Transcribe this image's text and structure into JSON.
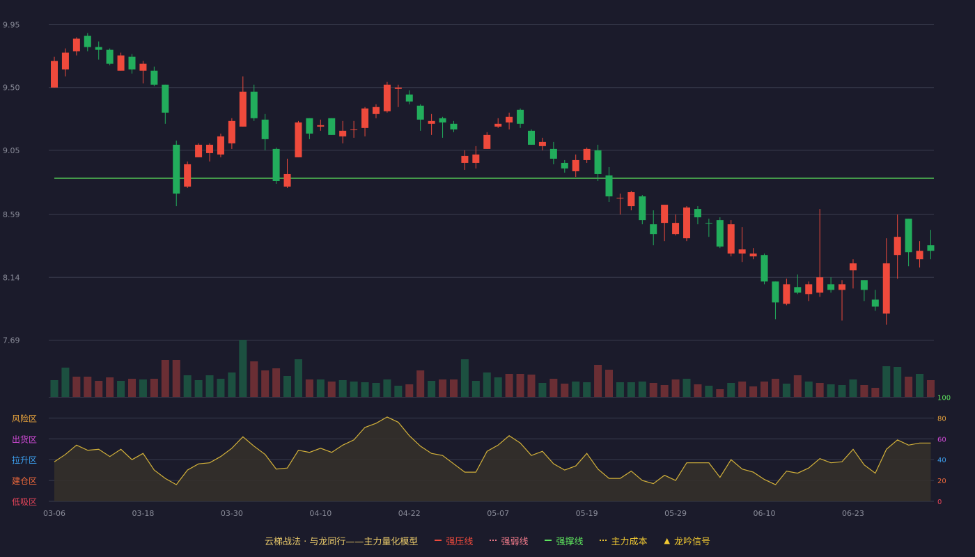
{
  "chart_data": {
    "type": "candlestick",
    "x_tick_labels": [
      "03-06",
      "03-18",
      "03-30",
      "04-10",
      "04-22",
      "05-07",
      "05-19",
      "05-29",
      "06-10",
      "06-23"
    ],
    "x_tick_indices": [
      0,
      8,
      16,
      24,
      32,
      40,
      48,
      56,
      64,
      72
    ],
    "price_axis": {
      "ticks": [
        "9.95",
        "9.50",
        "9.05",
        "8.59",
        "8.14",
        "7.69"
      ],
      "range": [
        7.69,
        9.95
      ]
    },
    "support_line": {
      "value": 8.85,
      "start_index": 0
    },
    "candles": [
      [
        9.5,
        9.69,
        9.72,
        9.5,
        "up"
      ],
      [
        9.63,
        9.75,
        9.78,
        9.58,
        "up"
      ],
      [
        9.76,
        9.85,
        9.86,
        9.73,
        "up"
      ],
      [
        9.87,
        9.79,
        9.89,
        9.76,
        "down"
      ],
      [
        9.79,
        9.77,
        9.83,
        9.7,
        "down"
      ],
      [
        9.77,
        9.67,
        9.78,
        9.66,
        "down"
      ],
      [
        9.62,
        9.73,
        9.75,
        9.62,
        "up"
      ],
      [
        9.72,
        9.63,
        9.74,
        9.6,
        "down"
      ],
      [
        9.62,
        9.67,
        9.69,
        9.53,
        "up"
      ],
      [
        9.62,
        9.52,
        9.65,
        9.51,
        "down"
      ],
      [
        9.52,
        9.32,
        9.52,
        9.24,
        "down"
      ],
      [
        9.09,
        8.74,
        9.12,
        8.65,
        "down"
      ],
      [
        8.79,
        8.95,
        8.97,
        8.78,
        "up"
      ],
      [
        9.0,
        9.09,
        9.1,
        9.0,
        "up"
      ],
      [
        9.03,
        9.09,
        9.1,
        8.97,
        "up"
      ],
      [
        9.02,
        9.15,
        9.17,
        9.0,
        "up"
      ],
      [
        9.1,
        9.26,
        9.28,
        9.06,
        "up"
      ],
      [
        9.22,
        9.47,
        9.58,
        9.22,
        "up"
      ],
      [
        9.47,
        9.28,
        9.52,
        9.26,
        "down"
      ],
      [
        9.27,
        9.13,
        9.31,
        9.05,
        "down"
      ],
      [
        9.06,
        8.83,
        9.07,
        8.81,
        "down"
      ],
      [
        8.79,
        8.88,
        8.99,
        8.78,
        "up"
      ],
      [
        9.0,
        9.25,
        9.26,
        9.0,
        "up"
      ],
      [
        9.28,
        9.17,
        9.28,
        9.13,
        "down"
      ],
      [
        9.22,
        9.23,
        9.27,
        9.19,
        "up"
      ],
      [
        9.28,
        9.16,
        9.28,
        9.16,
        "down"
      ],
      [
        9.15,
        9.19,
        9.26,
        9.1,
        "up"
      ],
      [
        9.2,
        9.2,
        9.26,
        9.14,
        "up"
      ],
      [
        9.21,
        9.35,
        9.36,
        9.15,
        "up"
      ],
      [
        9.31,
        9.36,
        9.38,
        9.28,
        "up"
      ],
      [
        9.33,
        9.52,
        9.54,
        9.32,
        "up"
      ],
      [
        9.49,
        9.5,
        9.52,
        9.36,
        "up"
      ],
      [
        9.45,
        9.4,
        9.48,
        9.38,
        "down"
      ],
      [
        9.37,
        9.27,
        9.38,
        9.19,
        "down"
      ],
      [
        9.24,
        9.26,
        9.31,
        9.16,
        "up"
      ],
      [
        9.28,
        9.25,
        9.29,
        9.14,
        "down"
      ],
      [
        9.24,
        9.2,
        9.26,
        9.18,
        "down"
      ],
      [
        8.96,
        9.01,
        9.05,
        8.91,
        "up"
      ],
      [
        8.96,
        9.02,
        9.08,
        8.92,
        "up"
      ],
      [
        9.06,
        9.16,
        9.18,
        9.06,
        "up"
      ],
      [
        9.22,
        9.24,
        9.28,
        9.21,
        "up"
      ],
      [
        9.25,
        9.29,
        9.32,
        9.2,
        "up"
      ],
      [
        9.34,
        9.24,
        9.35,
        9.21,
        "down"
      ],
      [
        9.19,
        9.09,
        9.2,
        9.09,
        "down"
      ],
      [
        9.08,
        9.11,
        9.14,
        9.05,
        "up"
      ],
      [
        9.06,
        8.99,
        9.11,
        8.95,
        "down"
      ],
      [
        8.96,
        8.92,
        8.98,
        8.89,
        "down"
      ],
      [
        8.9,
        8.98,
        9.02,
        8.86,
        "up"
      ],
      [
        8.98,
        9.06,
        9.07,
        8.96,
        "up"
      ],
      [
        9.05,
        8.88,
        9.09,
        8.83,
        "down"
      ],
      [
        8.87,
        8.72,
        8.93,
        8.68,
        "down"
      ],
      [
        8.71,
        8.71,
        8.74,
        8.59,
        "up"
      ],
      [
        8.65,
        8.75,
        8.76,
        8.62,
        "up"
      ],
      [
        8.72,
        8.55,
        8.73,
        8.52,
        "down"
      ],
      [
        8.52,
        8.45,
        8.62,
        8.37,
        "down"
      ],
      [
        8.53,
        8.66,
        8.66,
        8.4,
        "up"
      ],
      [
        8.45,
        8.53,
        8.59,
        8.44,
        "up"
      ],
      [
        8.42,
        8.64,
        8.65,
        8.4,
        "up"
      ],
      [
        8.63,
        8.57,
        8.65,
        8.52,
        "down"
      ],
      [
        8.53,
        8.53,
        8.56,
        8.43,
        "down"
      ],
      [
        8.55,
        8.36,
        8.57,
        8.35,
        "down"
      ],
      [
        8.31,
        8.52,
        8.55,
        8.29,
        "up"
      ],
      [
        8.31,
        8.34,
        8.5,
        8.25,
        "up"
      ],
      [
        8.29,
        8.31,
        8.35,
        8.27,
        "up"
      ],
      [
        8.3,
        8.11,
        8.31,
        8.09,
        "down"
      ],
      [
        8.11,
        7.96,
        8.11,
        7.84,
        "down"
      ],
      [
        7.95,
        8.09,
        8.13,
        7.94,
        "up"
      ],
      [
        8.03,
        8.07,
        8.16,
        8.02,
        "down"
      ],
      [
        8.02,
        8.09,
        8.11,
        7.97,
        "up"
      ],
      [
        8.03,
        8.14,
        8.63,
        8.0,
        "up"
      ],
      [
        8.09,
        8.05,
        8.14,
        8.03,
        "down"
      ],
      [
        8.05,
        8.09,
        8.12,
        7.83,
        "up"
      ],
      [
        8.19,
        8.24,
        8.27,
        8.06,
        "up"
      ],
      [
        8.05,
        8.12,
        8.12,
        7.97,
        "down"
      ],
      [
        7.98,
        7.93,
        8.05,
        7.9,
        "down"
      ],
      [
        7.88,
        8.24,
        8.42,
        7.8,
        "up"
      ],
      [
        8.3,
        8.43,
        8.59,
        8.13,
        "up"
      ],
      [
        8.56,
        8.32,
        8.56,
        8.22,
        "down"
      ],
      [
        8.27,
        8.33,
        8.4,
        8.21,
        "up"
      ],
      [
        8.37,
        8.33,
        8.48,
        8.27,
        "down"
      ]
    ],
    "volume": [
      [
        24,
        "down"
      ],
      [
        42,
        "down"
      ],
      [
        29,
        "up"
      ],
      [
        29,
        "up"
      ],
      [
        23,
        "up"
      ],
      [
        28,
        "up"
      ],
      [
        23,
        "down"
      ],
      [
        26,
        "up"
      ],
      [
        25,
        "down"
      ],
      [
        26,
        "up"
      ],
      [
        53,
        "up"
      ],
      [
        53,
        "up"
      ],
      [
        31,
        "down"
      ],
      [
        24,
        "down"
      ],
      [
        31,
        "down"
      ],
      [
        26,
        "down"
      ],
      [
        35,
        "down"
      ],
      [
        82,
        "down"
      ],
      [
        51,
        "up"
      ],
      [
        38,
        "up"
      ],
      [
        41,
        "up"
      ],
      [
        30,
        "down"
      ],
      [
        54,
        "down"
      ],
      [
        25,
        "up"
      ],
      [
        25,
        "down"
      ],
      [
        22,
        "up"
      ],
      [
        24,
        "down"
      ],
      [
        22,
        "down"
      ],
      [
        21,
        "down"
      ],
      [
        20,
        "down"
      ],
      [
        25,
        "down"
      ],
      [
        16,
        "down"
      ],
      [
        18,
        "up"
      ],
      [
        38,
        "up"
      ],
      [
        23,
        "down"
      ],
      [
        25,
        "up"
      ],
      [
        25,
        "up"
      ],
      [
        54,
        "down"
      ],
      [
        23,
        "down"
      ],
      [
        35,
        "down"
      ],
      [
        28,
        "down"
      ],
      [
        33,
        "up"
      ],
      [
        33,
        "up"
      ],
      [
        32,
        "up"
      ],
      [
        20,
        "down"
      ],
      [
        26,
        "up"
      ],
      [
        19,
        "up"
      ],
      [
        22,
        "down"
      ],
      [
        21,
        "down"
      ],
      [
        46,
        "up"
      ],
      [
        39,
        "up"
      ],
      [
        21,
        "down"
      ],
      [
        21,
        "down"
      ],
      [
        22,
        "down"
      ],
      [
        20,
        "up"
      ],
      [
        17,
        "up"
      ],
      [
        25,
        "up"
      ],
      [
        26,
        "down"
      ],
      [
        18,
        "up"
      ],
      [
        16,
        "down"
      ],
      [
        11,
        "up"
      ],
      [
        20,
        "down"
      ],
      [
        22,
        "up"
      ],
      [
        15,
        "up"
      ],
      [
        22,
        "up"
      ],
      [
        26,
        "up"
      ],
      [
        19,
        "down"
      ],
      [
        31,
        "up"
      ],
      [
        22,
        "down"
      ],
      [
        20,
        "up"
      ],
      [
        18,
        "down"
      ],
      [
        17,
        "down"
      ],
      [
        25,
        "down"
      ],
      [
        17,
        "up"
      ],
      [
        13,
        "up"
      ],
      [
        44,
        "down"
      ],
      [
        43,
        "down"
      ],
      [
        29,
        "up"
      ],
      [
        33,
        "down"
      ],
      [
        24,
        "up"
      ]
    ],
    "oscillator": {
      "zone_labels": [
        "风险区",
        "出货区",
        "拉升区",
        "建仓区",
        "低吸区"
      ],
      "zone_colors": [
        "#e8a33c",
        "#d24bd8",
        "#3ca0f0",
        "#f06a3c",
        "#e8455a"
      ],
      "right_ticks": [
        "100",
        "80",
        "60",
        "40",
        "20",
        "0"
      ],
      "right_tick_colors": [
        "#5ee65e",
        "#e8a33c",
        "#d24bd8",
        "#3ca0f0",
        "#f06a3c",
        "#e8455a"
      ],
      "range": [
        0,
        100
      ],
      "values": [
        38,
        45,
        54,
        49,
        50,
        43,
        50,
        40,
        46,
        30,
        22,
        16,
        30,
        36,
        37,
        43,
        51,
        62,
        53,
        45,
        31,
        32,
        49,
        47,
        51,
        47,
        54,
        59,
        71,
        75,
        81,
        76,
        63,
        53,
        46,
        44,
        36,
        28,
        28,
        48,
        54,
        63,
        56,
        44,
        48,
        36,
        30,
        34,
        46,
        31,
        22,
        22,
        29,
        20,
        17,
        25,
        20,
        37,
        37,
        37,
        23,
        40,
        31,
        28,
        21,
        16,
        29,
        27,
        32,
        41,
        37,
        38,
        50,
        35,
        27,
        50,
        59,
        54,
        56,
        56
      ]
    },
    "legend": {
      "title": "云梯战法 · 与龙同行——主力量化模型",
      "items": [
        {
          "label": "强压线",
          "color": "#ef4a3c",
          "style": "solid"
        },
        {
          "label": "强弱线",
          "color": "#f07a8a",
          "style": "dotted"
        },
        {
          "label": "强撑线",
          "color": "#5ee65e",
          "style": "solid"
        },
        {
          "label": "主力成本",
          "color": "#f0c832",
          "style": "dotted"
        },
        {
          "label": "龙吟信号",
          "color": "#f0c832",
          "style": "triangle"
        }
      ]
    },
    "colors": {
      "up": "#ef4a3c",
      "down": "#22ad5c",
      "vol_up": "#6a2e34",
      "vol_down": "#1c5040",
      "osc_line": "#d4b23a",
      "grid": "#3a3c4e",
      "axis_text": "#8a8c99"
    }
  }
}
